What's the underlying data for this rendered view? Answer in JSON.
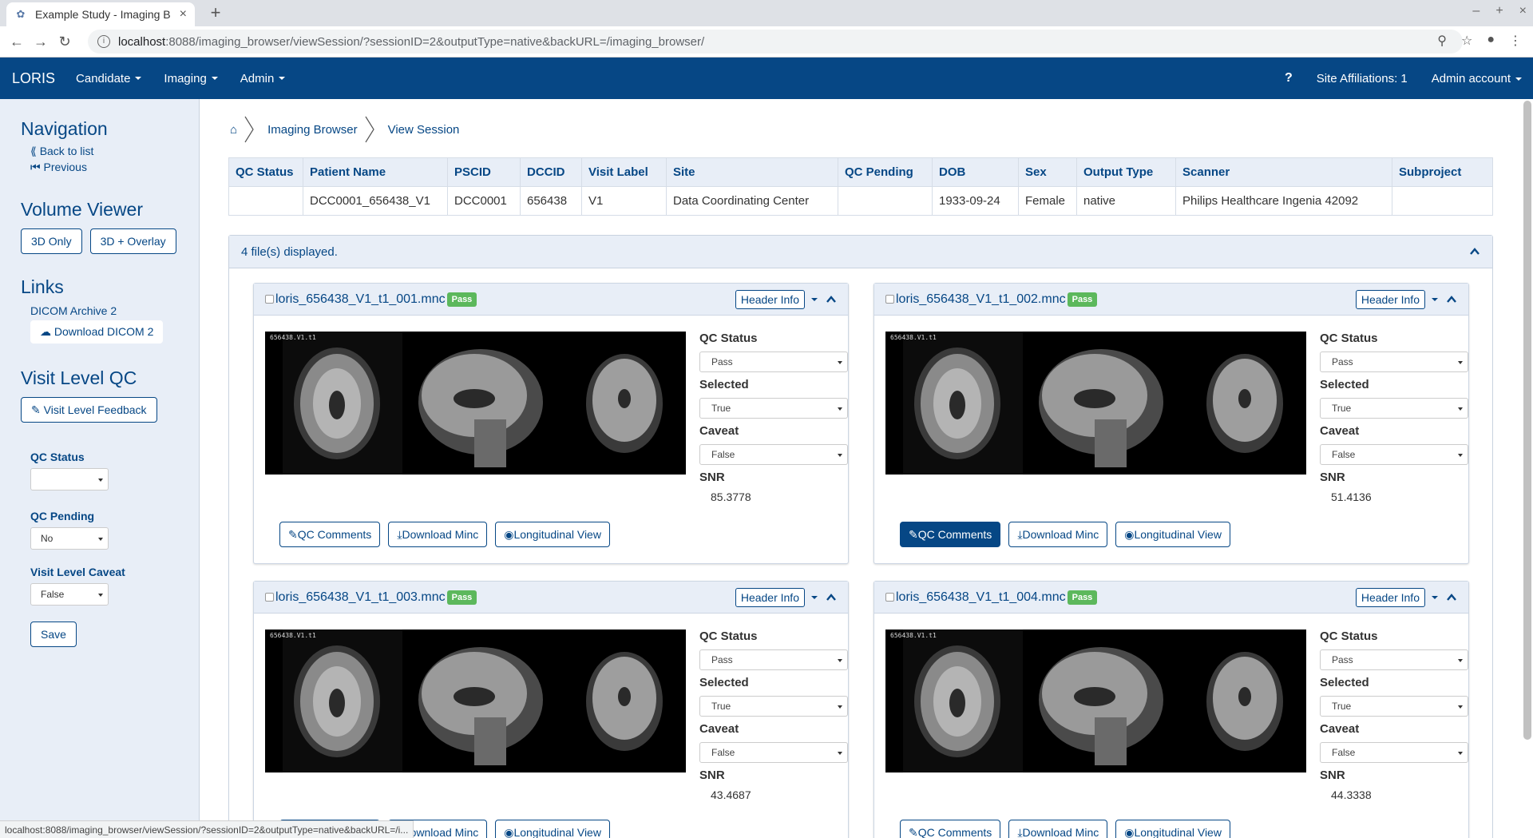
{
  "browser": {
    "tab_title": "Example Study - Imaging B",
    "url_host": "localhost",
    "url_rest": ":8088/imaging_browser/viewSession/?sessionID=2&outputType=native&backURL=/imaging_browser/",
    "status_url": "localhost:8088/imaging_browser/viewSession/?sessionID=2&outputType=native&backURL=/i..."
  },
  "navbar": {
    "brand": "LORIS",
    "menus": [
      "Candidate",
      "Imaging",
      "Admin"
    ],
    "help": "?",
    "site_affiliations": "Site Affiliations: 1",
    "account": "Admin account"
  },
  "sidebar": {
    "nav_title": "Navigation",
    "back_to_list": "Back to list",
    "previous": "Previous",
    "volume_title": "Volume Viewer",
    "btn_3d_only": "3D Only",
    "btn_3d_overlay": "3D + Overlay",
    "links_title": "Links",
    "dicom_archive": "DICOM Archive 2",
    "download_dicom": "Download DICOM 2",
    "visit_qc_title": "Visit Level QC",
    "visit_feedback": "Visit Level Feedback",
    "qc_status_label": "QC Status",
    "qc_status_value": "",
    "qc_pending_label": "QC Pending",
    "qc_pending_value": "No",
    "visit_caveat_label": "Visit Level Caveat",
    "visit_caveat_value": "False",
    "save": "Save"
  },
  "breadcrumb": [
    "Imaging Browser",
    "View Session"
  ],
  "summary": {
    "headers": [
      "QC Status",
      "Patient Name",
      "PSCID",
      "DCCID",
      "Visit Label",
      "Site",
      "QC Pending",
      "DOB",
      "Sex",
      "Output Type",
      "Scanner",
      "Subproject"
    ],
    "row": [
      "",
      "DCC0001_656438_V1",
      "DCC0001",
      "656438",
      "V1",
      "Data Coordinating Center",
      "",
      "1933-09-24",
      "Female",
      "native",
      "Philips Healthcare Ingenia 42092",
      ""
    ]
  },
  "files_panel": {
    "count_text": "4 file(s) displayed."
  },
  "file_labels": {
    "header_info": "Header Info",
    "qc_status": "QC Status",
    "selected": "Selected",
    "caveat": "Caveat",
    "snr": "SNR",
    "qc_comments": "QC Comments",
    "download_minc": "Download Minc",
    "longitudinal_view": "Longitudinal View",
    "scan_tag": "656438.V1.t1"
  },
  "files": [
    {
      "name": "loris_656438_V1_t1_001.mnc",
      "badge": "Pass",
      "qc_status": "Pass",
      "selected": "True",
      "caveat": "False",
      "snr": "85.3778"
    },
    {
      "name": "loris_656438_V1_t1_002.mnc",
      "badge": "Pass",
      "qc_status": "Pass",
      "selected": "True",
      "caveat": "False",
      "snr": "51.4136"
    },
    {
      "name": "loris_656438_V1_t1_003.mnc",
      "badge": "Pass",
      "qc_status": "Pass",
      "selected": "True",
      "caveat": "False",
      "snr": "43.4687"
    },
    {
      "name": "loris_656438_V1_t1_004.mnc",
      "badge": "Pass",
      "qc_status": "Pass",
      "selected": "True",
      "caveat": "False",
      "snr": "44.3338"
    }
  ],
  "colors": {
    "brand": "#064785",
    "pass": "#5cb85c",
    "sidebar_bg": "#e8eef7"
  }
}
